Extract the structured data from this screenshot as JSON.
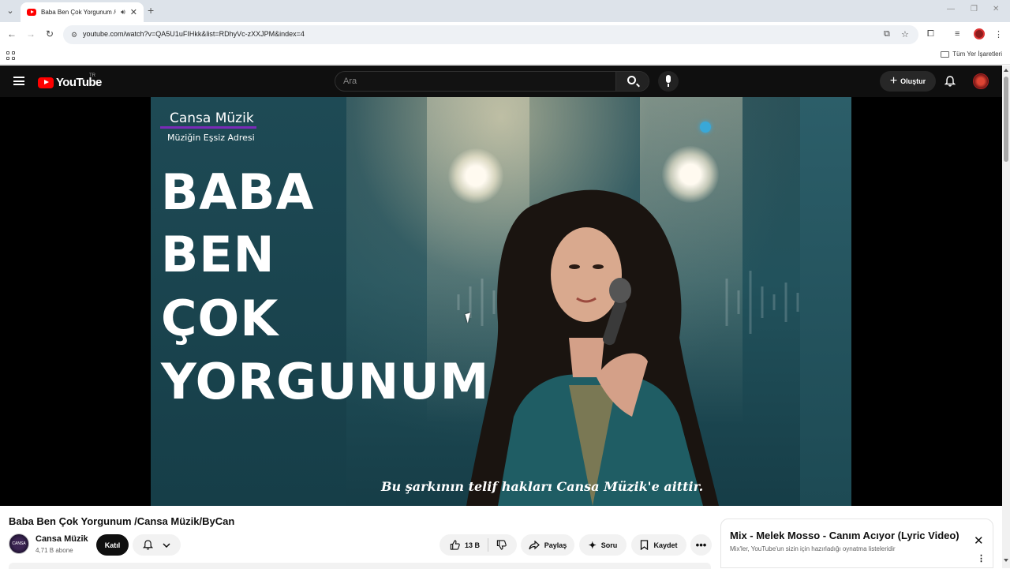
{
  "browser": {
    "tab_title": "Baba Ben Çok Yorgunum /C",
    "url": "youtube.com/watch?v=QA5U1uFIHkk&list=RDhyVc-zXXJPM&index=4",
    "bookmarks_all": "Tüm Yer İşaretleri"
  },
  "masthead": {
    "logo_text": "YouTube",
    "region": "TR",
    "search_placeholder": "Ara",
    "create_label": "Oluştur"
  },
  "video_frame": {
    "brand": "Cansa Müzik",
    "brand_sub": "Müziğin Eşsiz Adresi",
    "title_lines": [
      "BABA",
      "BEN",
      "ÇOK",
      "YORGUNUM"
    ],
    "copyright": "Bu şarkının telif hakları Cansa Müzik'e aittir."
  },
  "video": {
    "title": "Baba Ben Çok Yorgunum /Cansa Müzik/ByCan",
    "channel_name": "Cansa Müzik",
    "subscribers": "4,71 B abone",
    "join_label": "Katıl",
    "likes": "13 B",
    "share_label": "Paylaş",
    "ask_label": "Soru",
    "save_label": "Kaydet",
    "channel_avatar_text": "CANSA"
  },
  "mix": {
    "title": "Mix - Melek Mosso - Canım Acıyor (Lyric Video)",
    "description": "Mix'ler, YouTube'un sizin için hazırladığı oynatma listeleridir"
  },
  "colors": {
    "youtube_red": "#ff0000",
    "masthead_bg": "#0f0f0f",
    "brand_underline": "#7a2bb8"
  }
}
